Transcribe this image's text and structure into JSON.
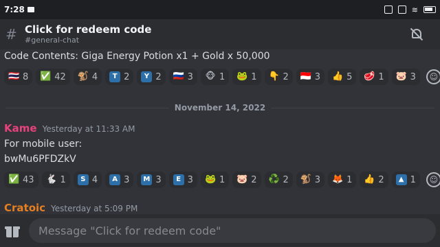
{
  "statusbar": {
    "time": "7:28",
    "battery": "71"
  },
  "channel": {
    "title": "Click for redeem code",
    "subtitle": "#general-chat"
  },
  "messages": {
    "code_line": "Code Contents: Giga Energy Potion x1 + Gold x 50,000",
    "reactions_1": [
      {
        "emoji": "🇹🇭",
        "count": "8",
        "bg": ""
      },
      {
        "emoji": "✅",
        "count": "42",
        "bg": ""
      },
      {
        "emoji": "🐒",
        "count": "4",
        "bg": ""
      },
      {
        "emoji": "T",
        "count": "2",
        "bg": "#2d6fa8"
      },
      {
        "emoji": "Y",
        "count": "2",
        "bg": "#2d6fa8"
      },
      {
        "emoji": "🇷🇺",
        "count": "3",
        "bg": ""
      },
      {
        "emoji": "🐵",
        "count": "1",
        "bg": ""
      },
      {
        "emoji": "🐸",
        "count": "1",
        "bg": ""
      },
      {
        "emoji": "👇",
        "count": "2",
        "bg": ""
      },
      {
        "emoji": "🇮🇩",
        "count": "3",
        "bg": ""
      },
      {
        "emoji": "👍",
        "count": "5",
        "bg": ""
      },
      {
        "emoji": "🥩",
        "count": "1",
        "bg": ""
      },
      {
        "emoji": "🐷",
        "count": "3",
        "bg": ""
      }
    ],
    "date_divider": "November 14, 2022",
    "msg2": {
      "author": "Kame",
      "author_color": "#e8427a",
      "timestamp": "Yesterday at 11:33 AM",
      "line1": "For mobile user:",
      "line2": "bwMu6PFDZkV"
    },
    "reactions_2": [
      {
        "emoji": "✅",
        "count": "43",
        "bg": ""
      },
      {
        "emoji": "🐇",
        "count": "1",
        "bg": ""
      },
      {
        "emoji": "S",
        "count": "4",
        "bg": "#2d6fa8"
      },
      {
        "emoji": "A",
        "count": "3",
        "bg": "#2d6fa8"
      },
      {
        "emoji": "M",
        "count": "3",
        "bg": "#2d6fa8"
      },
      {
        "emoji": "E",
        "count": "3",
        "bg": "#2d6fa8"
      },
      {
        "emoji": "🐸",
        "count": "1",
        "bg": ""
      },
      {
        "emoji": "🐷",
        "count": "2",
        "bg": ""
      },
      {
        "emoji": "♻️",
        "count": "2",
        "bg": ""
      },
      {
        "emoji": "🐒",
        "count": "3",
        "bg": ""
      },
      {
        "emoji": "🦊",
        "count": "1",
        "bg": ""
      },
      {
        "emoji": "👍",
        "count": "2",
        "bg": ""
      },
      {
        "emoji": "▲",
        "count": "1",
        "bg": "#2d6fa8"
      }
    ],
    "msg3": {
      "author": "Cratoic",
      "author_color": "#e67e22",
      "timestamp": "Yesterday at 5:09 PM"
    }
  },
  "composer": {
    "placeholder": "Message \"Click for redeem code\""
  },
  "icons": {
    "channel": "hash-icon",
    "mute": "bell-slash-icon",
    "gift": "gift-icon",
    "add_reaction": "add-reaction-icon"
  }
}
